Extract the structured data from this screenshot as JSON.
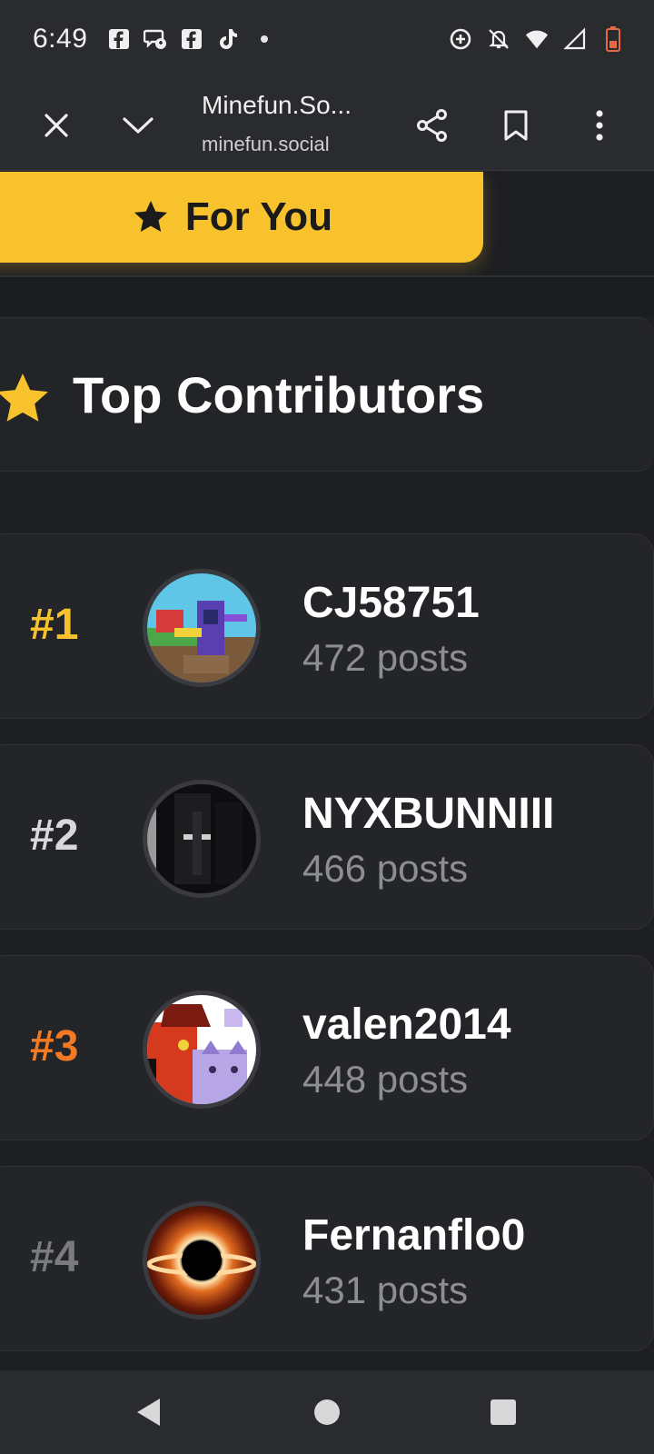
{
  "status_bar": {
    "time": "6:49",
    "left_icons": [
      "facebook-icon",
      "messenger-icon",
      "facebook-icon",
      "tiktok-icon",
      "dot-icon"
    ],
    "right_icons": [
      "data-saver-icon",
      "bell-off-icon",
      "wifi-icon",
      "signal-icon",
      "battery-icon"
    ]
  },
  "browser": {
    "title": "Minefun.So...",
    "url": "minefun.social"
  },
  "tabs": {
    "active_label": "For You"
  },
  "section": {
    "title": "Top Contributors"
  },
  "contributors": [
    {
      "rank": "#1",
      "name": "CJ58751",
      "posts": "472 posts",
      "rank_color": "#f8c22d"
    },
    {
      "rank": "#2",
      "name": "NYXBUNNIII",
      "posts": "466 posts",
      "rank_color": "#d9d9dc"
    },
    {
      "rank": "#3",
      "name": "valen2014",
      "posts": "448 posts",
      "rank_color": "#f37a22"
    },
    {
      "rank": "#4",
      "name": "Fernanflo0",
      "posts": "431 posts",
      "rank_color": "#7a7b80"
    }
  ],
  "colors": {
    "accent": "#f8c22d",
    "background": "#1e1f22",
    "card": "#242528",
    "muted_text": "#8d8e93"
  }
}
